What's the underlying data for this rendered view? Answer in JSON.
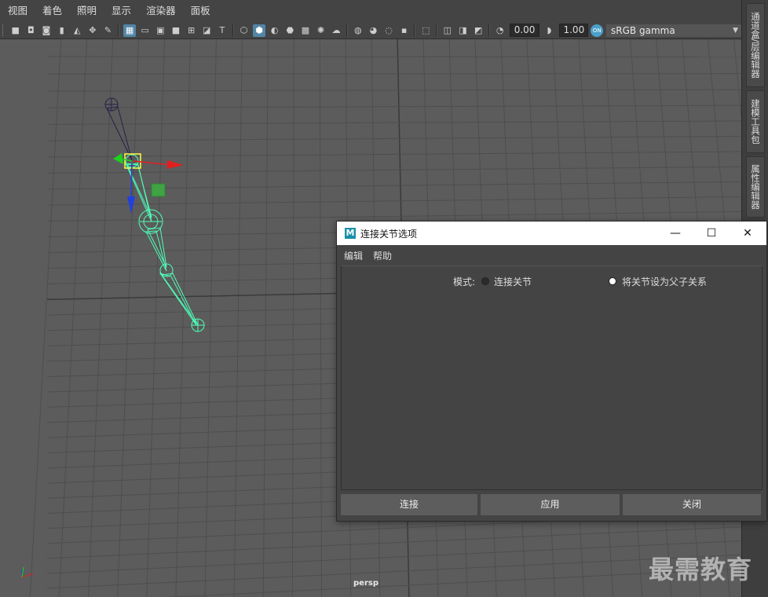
{
  "menubar": {
    "items": [
      "视图",
      "着色",
      "照明",
      "显示",
      "渲染器",
      "面板"
    ]
  },
  "toolbar": {
    "field1_value": "0.00",
    "field2_value": "1.00",
    "colorspace": "sRGB gamma",
    "colorspace_icon": "color-management-icon",
    "accent": "#5285a6"
  },
  "viewport": {
    "camera": "persp",
    "background": "#5c5c5c",
    "grid_color": "#4e4e4e",
    "axis_color": "#3a3a3a",
    "joint_selected_color": "#4dffb8",
    "joint_parent_color": "#2a1f4a"
  },
  "side_tabs": [
    "通道盒/层编辑器",
    "建模工具包",
    "属性编辑器"
  ],
  "dialog": {
    "title": "连接关节选项",
    "menu": [
      "编辑",
      "帮助"
    ],
    "mode_label": "模式:",
    "options": [
      {
        "label": "连接关节",
        "selected": false
      },
      {
        "label": "将关节设为父子关系",
        "selected": true
      }
    ],
    "buttons": [
      "连接",
      "应用",
      "关闭"
    ],
    "window_controls": {
      "minimize": "—",
      "maximize": "☐",
      "close": "✕"
    }
  },
  "watermark": "最需教育"
}
